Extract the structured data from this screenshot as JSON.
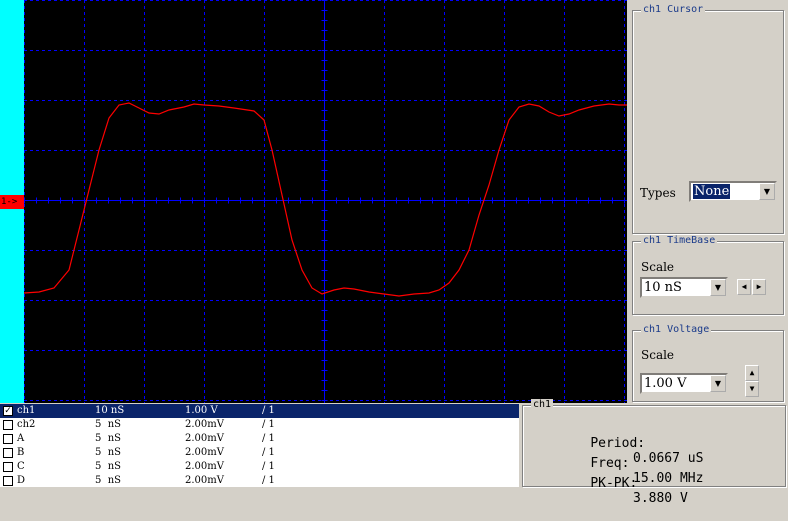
{
  "scope": {
    "channel_marker": "1->",
    "trace_color": "#ff0000",
    "grid_color": "#0000ff",
    "left_strip_color": "#00ffff",
    "waveform": "square-ish signal, ~15 MHz"
  },
  "cursor_panel": {
    "title": "ch1 Cursor",
    "types_label": "Types",
    "types_value": "None"
  },
  "timebase_panel": {
    "title": "ch1 TimeBase",
    "scale_label": "Scale",
    "scale_value": "10 nS"
  },
  "voltage_panel": {
    "title": "ch1 Voltage",
    "scale_label": "Scale",
    "scale_value": "1.00 V"
  },
  "channels": [
    {
      "checked": true,
      "name": "ch1",
      "time": "10 nS",
      "volt": "1.00 V",
      "ratio": "/ 1"
    },
    {
      "checked": false,
      "name": "ch2",
      "time": "5  nS",
      "volt": "2.00mV",
      "ratio": "/ 1"
    },
    {
      "checked": false,
      "name": "A",
      "time": "5  nS",
      "volt": "2.00mV",
      "ratio": "/ 1"
    },
    {
      "checked": false,
      "name": "B",
      "time": "5  nS",
      "volt": "2.00mV",
      "ratio": "/ 1"
    },
    {
      "checked": false,
      "name": "C",
      "time": "5  nS",
      "volt": "2.00mV",
      "ratio": "/ 1"
    },
    {
      "checked": false,
      "name": "D",
      "time": "5  nS",
      "volt": "2.00mV",
      "ratio": "/ 1"
    }
  ],
  "measurements": {
    "title": "ch1",
    "period_label": "Period:",
    "period_value": "0.0667 uS",
    "freq_label": "Freq:",
    "freq_value": "15.00 MHz",
    "pkpk_label": "PK-PK:",
    "pkpk_value": "3.880 V"
  }
}
